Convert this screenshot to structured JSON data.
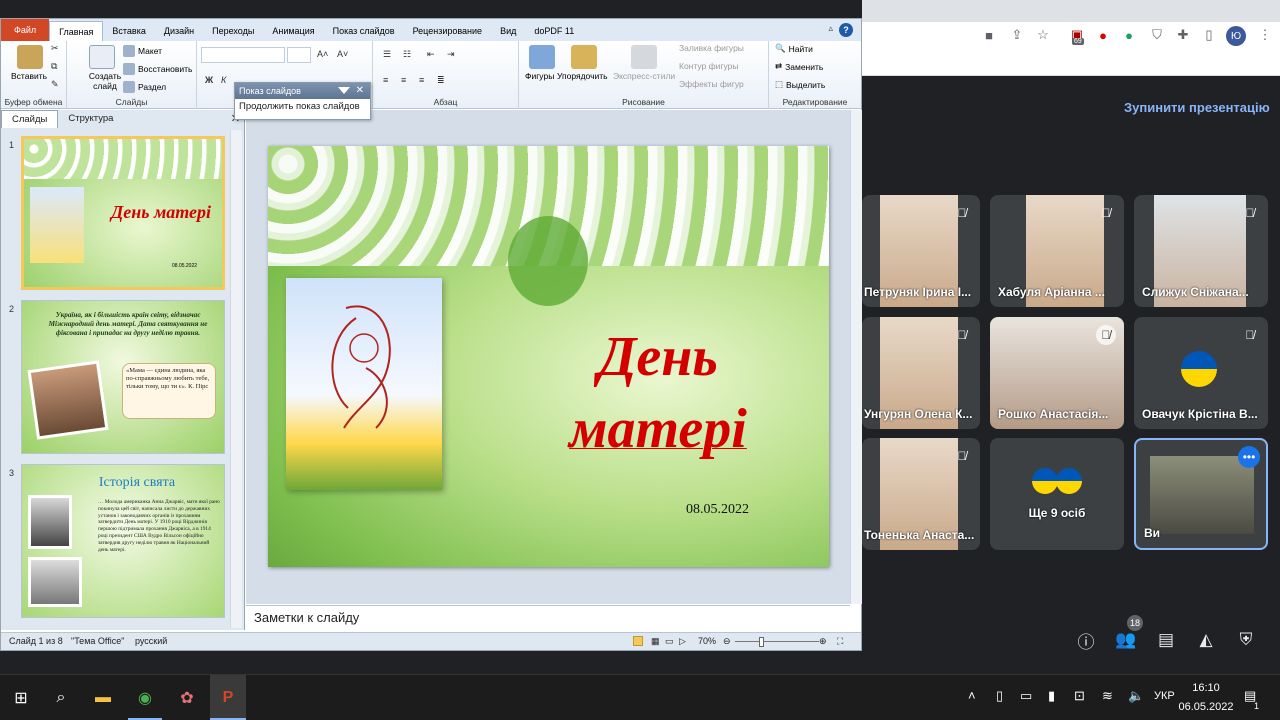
{
  "ppt": {
    "tabs": [
      "Файл",
      "Главная",
      "Вставка",
      "Дизайн",
      "Переходы",
      "Анимация",
      "Показ слайдов",
      "Рецензирование",
      "Вид",
      "doPDF 11"
    ],
    "ribbon": {
      "paste": "Вставить",
      "clipboard": "Буфер обмена",
      "new_slide": "Создать слайд",
      "layout": "Макет",
      "reset": "Восстановить",
      "section": "Раздел",
      "slides_group": "Слайды",
      "paragraph_group": "Абзац",
      "shapes": "Фигуры",
      "arrange": "Упорядочить",
      "quick_styles": "Экспресс-стили",
      "shape_fill": "Заливка фигуры",
      "shape_outline": "Контур фигуры",
      "shape_effects": "Эффекты фигур",
      "drawing_group": "Рисование",
      "find": "Найти",
      "replace": "Заменить",
      "select": "Выделить",
      "editing_group": "Редактирование"
    },
    "popup": {
      "title": "Показ слайдов",
      "action": "Продолжить показ слайдов"
    },
    "left_tabs": [
      "Слайды",
      "Структура"
    ],
    "thumbs": [
      {
        "num": "1",
        "title": "День матері",
        "date": "08.05.2022"
      },
      {
        "num": "2",
        "text": "Україна, як і більшість країн світу, відзначає Міжнародний день матері. Дата святкування не фіксована і припадає на другу неділю травня.",
        "quote": "«Мама — єдина людина, яка по-справжньому любить тебе, тільки тому, що ти є». К. Пірс"
      },
      {
        "num": "3",
        "title": "Історія свята",
        "text": "… Молода американка Анна Джарвіс, мати якої рано покинула цей світ, написала листи до державних установ і законодавчих органів із проханням затвердити День матері. У 1910 році Вірджинія першою підтримала прохання Джарвіса, а в 1914 році президент США Вудро Вільсон офіційно затвердив другу неділю травня як Національний день матері."
      }
    ],
    "slide": {
      "title_line1": "День",
      "title_line2": "матері",
      "date": "08.05.2022"
    },
    "notes_placeholder": "Заметки к слайду",
    "status": {
      "slide": "Слайд 1 из 8",
      "theme": "\"Тема Office\"",
      "lang": "русский",
      "zoom": "70%"
    }
  },
  "meet": {
    "stop_presenting": "Зупинити презентацію",
    "participants": [
      {
        "name": "Петруняк Ірина І..."
      },
      {
        "name": "Хабуля Аріанна ..."
      },
      {
        "name": "Слижук Сніжана..."
      },
      {
        "name": "Унгурян Олена К..."
      },
      {
        "name": "Рошко Анастасія..."
      },
      {
        "name": "Овачук Крістіна В..."
      },
      {
        "name": "Тоненька Анаста..."
      },
      {
        "name": "Ще 9 осіб"
      },
      {
        "name": "Ви"
      }
    ],
    "people_count": "18",
    "chrome_avatar": "Ю",
    "ext_badge": "69"
  },
  "taskbar": {
    "lang": "УКР",
    "time": "16:10",
    "date": "06.05.2022",
    "notif": "1"
  }
}
